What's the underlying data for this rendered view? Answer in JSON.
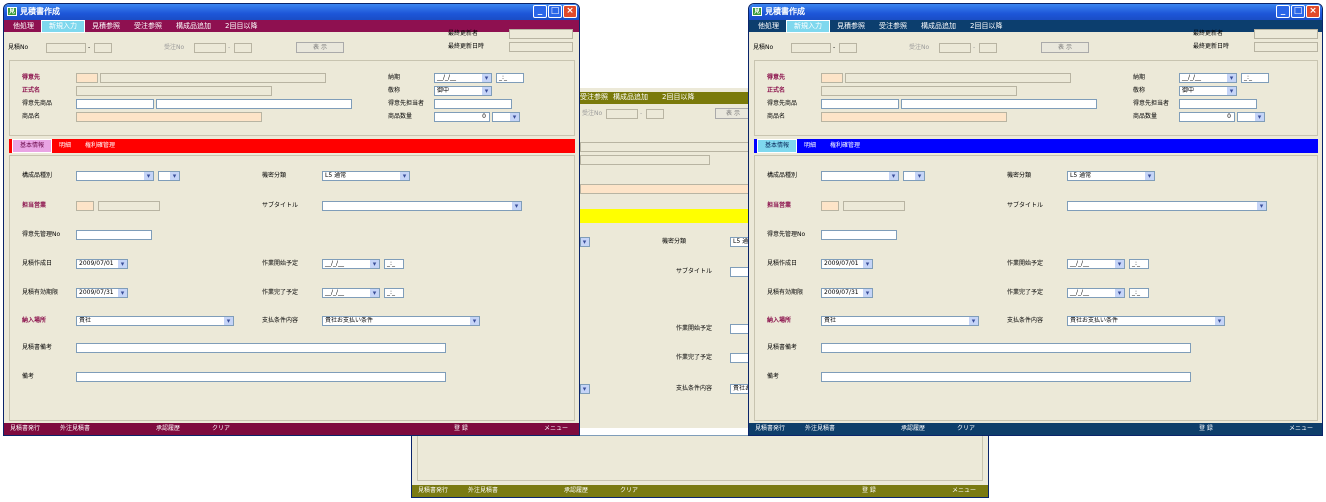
{
  "title": "見積書作成",
  "menu": {
    "items": [
      "他処理",
      "新規入力",
      "見積参照",
      "受注参照",
      "構成品追加",
      "2回目以降"
    ],
    "active": 1
  },
  "header": {
    "last_updater_label": "最終更新者",
    "last_updated_label": "最終更新日時",
    "quote_no_label": "見積No",
    "order_no_label": "受注No",
    "sep": "-",
    "show_button": "表 示"
  },
  "customer": {
    "customer_label": "得意先",
    "formal_name_label": "正式名",
    "customer_product_label": "得意先商品",
    "product_name_label": "商品名",
    "delivery_label": "納期",
    "date_placeholder": "__/_/__",
    "time_placeholder": "_:_",
    "honorific_label": "敬称",
    "honorific_value": "御中",
    "contact_label": "得意先担当者",
    "quantity_label": "商品数量",
    "quantity_value": "0"
  },
  "tabs": [
    "基本情報",
    "明細",
    "権利確管理"
  ],
  "basic": {
    "component_type_label": "構成品種別",
    "secret_class_label": "機密分類",
    "secret_class_value": "L5 通常",
    "sales_label": "担当営業",
    "subtitle_label": "サブタイトル",
    "mgmt_no_label": "得意先管理No",
    "created_date_label": "見積作成日",
    "created_date_value": "2009/07/01",
    "work_start_label": "作業開始予定",
    "valid_until_label": "見積有効期限",
    "valid_until_value": "2009/07/31",
    "work_end_label": "作業完了予定",
    "delivery_place_label": "納入場所",
    "delivery_place_value": "貴社",
    "payment_label": "支払条件内容",
    "payment_value": "貴社お支払い条件",
    "quote_note_label": "見積書備考",
    "note_label": "備考"
  },
  "bottom": {
    "issue": "見積書発行",
    "outsource": "外注見積書",
    "approval": "承認履歴",
    "clear": "クリア",
    "register": "登 録",
    "menu": "メニュー"
  },
  "themes": {
    "left": {
      "menu_color": "#8e1050",
      "tab_color": "#ff0000",
      "bottom_color": "#7e0a3e"
    },
    "middle": {
      "menu_color": "#7a7a0a",
      "tab_color": "#ffff00",
      "bottom_color": "#7a7a12"
    },
    "right": {
      "menu_color": "#0c3e6e",
      "tab_color": "#0000ff",
      "bottom_color": "#0e3e6a"
    }
  },
  "icons": {
    "app": "app-icon",
    "minimize": "minimize-icon",
    "maximize": "maximize-icon",
    "close": "close-icon"
  }
}
